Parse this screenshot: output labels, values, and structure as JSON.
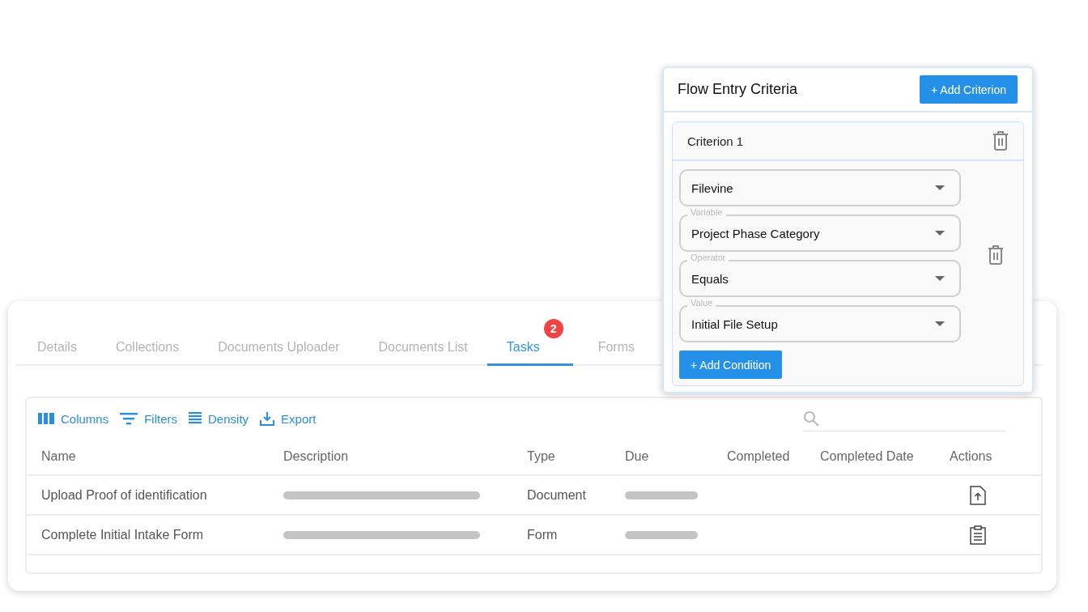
{
  "tabs": [
    {
      "label": "Details",
      "selected": false
    },
    {
      "label": "Collections",
      "selected": false
    },
    {
      "label": "Documents Uploader",
      "selected": false
    },
    {
      "label": "Documents List",
      "selected": false
    },
    {
      "label": "Tasks",
      "selected": true,
      "badge": "2"
    },
    {
      "label": "Forms",
      "selected": false
    }
  ],
  "toolbar": [
    {
      "kind": "columns",
      "label": "Columns"
    },
    {
      "kind": "filters",
      "label": "Filters"
    },
    {
      "kind": "density",
      "label": "Density"
    },
    {
      "kind": "export",
      "label": "Export"
    }
  ],
  "table": {
    "columns": [
      "Name",
      "Description",
      "Type",
      "Due",
      "Completed",
      "Completed Date",
      "Actions"
    ],
    "rows": [
      {
        "name": "Upload Proof of identification",
        "type": "Document",
        "kind": "upload"
      },
      {
        "name": "Complete Initial Intake Form",
        "type": "Form",
        "kind": "clipboard"
      }
    ]
  },
  "criteria_panel": {
    "title": "Flow Entry Criteria",
    "add_button": "+ Add Criterion",
    "criteria": [
      {
        "title": "Criterion 1",
        "fields": [
          {
            "value": "Filevine"
          },
          {
            "label": "Variable",
            "value": "Project Phase Category"
          },
          {
            "label": "Operator",
            "value": "Equals"
          },
          {
            "label": "Value",
            "value": "Initial File Setup"
          }
        ],
        "add_condition": "+ Add Condition"
      }
    ]
  }
}
